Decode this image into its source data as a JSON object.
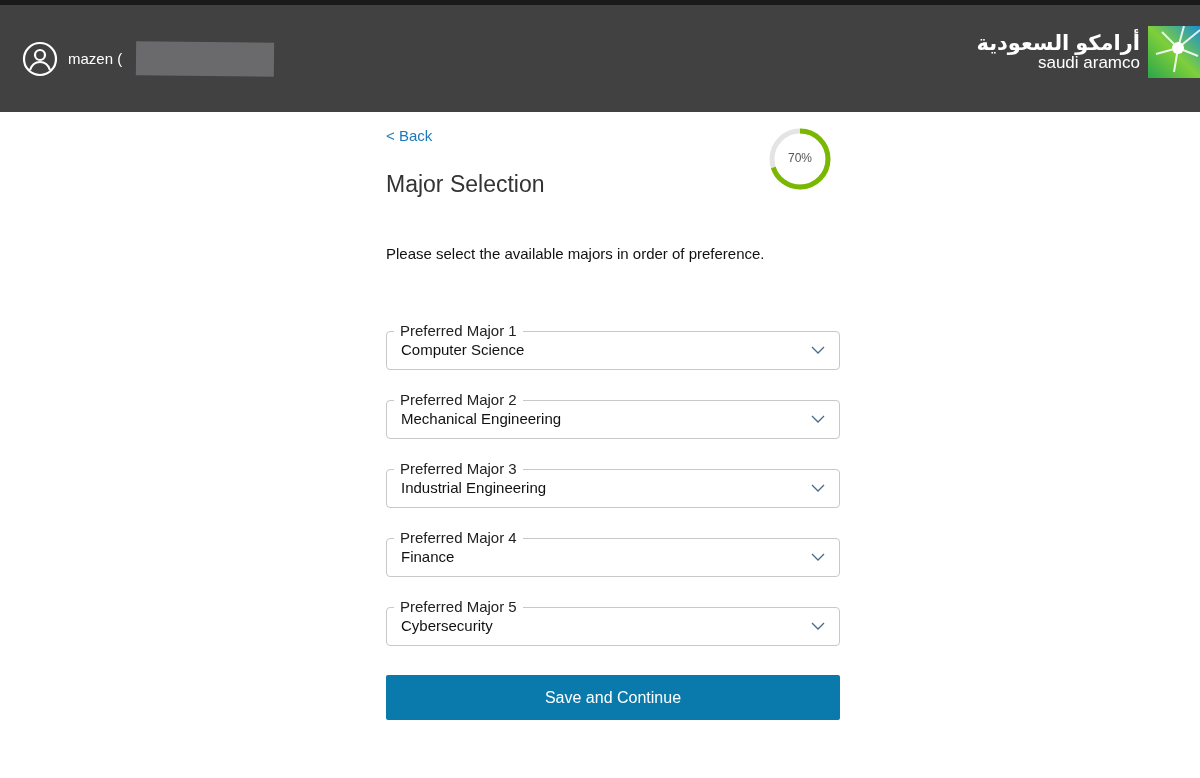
{
  "header": {
    "user_name": "mazen (",
    "logo": {
      "arabic": "أرامكو السعودية",
      "latin": "saudi aramco"
    }
  },
  "back_link": "< Back",
  "progress": {
    "level": 0.7,
    "label": "70%"
  },
  "title": "Major Selection",
  "instructions": "Please select the available majors in order of preference.",
  "majors": [
    {
      "label": "Preferred Major 1",
      "value": "Computer Science"
    },
    {
      "label": "Preferred Major 2",
      "value": "Mechanical Engineering"
    },
    {
      "label": "Preferred Major 3",
      "value": "Industrial Engineering"
    },
    {
      "label": "Preferred Major 4",
      "value": "Finance"
    },
    {
      "label": "Preferred Major 5",
      "value": "Cybersecurity"
    }
  ],
  "submit_button": "Save and Continue"
}
